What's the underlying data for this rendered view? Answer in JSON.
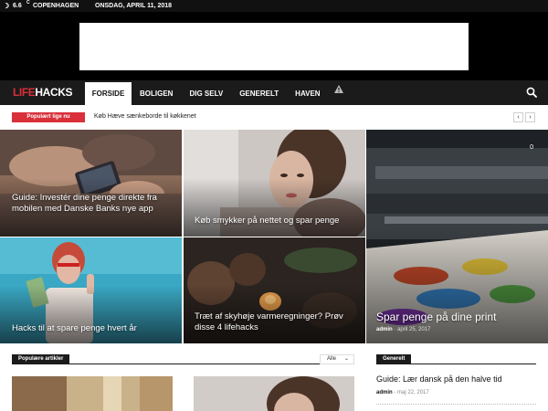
{
  "topbar": {
    "weather_icon": "moon-icon",
    "temperature": "6.6",
    "unit": "C",
    "city": "COPENHAGEN",
    "date": "ONSDAG, APRIL 11, 2018"
  },
  "header": {
    "logo_part1": "LIFE",
    "logo_part2": "HACKS",
    "nav": [
      "FORSIDE",
      "BOLIGEN",
      "DIG SELV",
      "GENERELT",
      "HAVEN"
    ],
    "icons": [
      "warning-icon",
      "search-icon"
    ]
  },
  "ticker": {
    "badge": "Populært lige nu",
    "text": "Køb Hæve sænkeborde til køkkenet",
    "prev": "‹",
    "next": "›"
  },
  "tiles": [
    {
      "title": "Guide: Investér dine penge direkte fra mobilen med Danske Banks nye app"
    },
    {
      "title": "Køb smykker på nettet og spar penge"
    },
    {
      "title": "Hacks til at spare penge hvert år"
    },
    {
      "title": "Træt af skyhøje varmeregninger? Prøv disse 4 lifehacks"
    },
    {
      "title": "Spar penge på dine print",
      "author": "admin",
      "date": "april 25, 2017",
      "count": "0"
    }
  ],
  "popular": {
    "label": "Populære artikler",
    "filter": "Alle"
  },
  "sidebar": {
    "category": "Generelt",
    "article_title": "Guide: Lær dansk på den halve tid",
    "author": "admin",
    "date": "maj 22, 2017"
  },
  "colors": {
    "accent": "#d9303a",
    "dark": "#1b1b1b"
  }
}
